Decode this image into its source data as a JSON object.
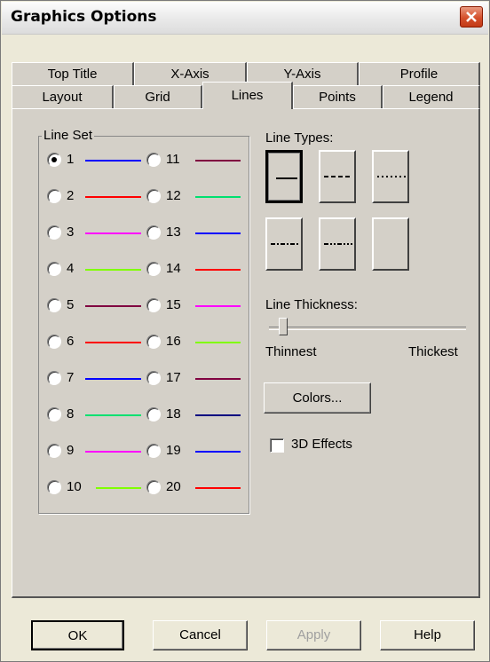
{
  "window": {
    "title": "Graphics Options"
  },
  "tabs": {
    "back_row": [
      "Top Title",
      "X-Axis",
      "Y-Axis",
      "Profile"
    ],
    "front_row": [
      "Layout",
      "Grid",
      "Lines",
      "Points",
      "Legend"
    ],
    "active": "Lines"
  },
  "line_set": {
    "label": "Line Set",
    "selected": "1",
    "items": [
      {
        "label": "1",
        "color": "#0000ff"
      },
      {
        "label": "2",
        "color": "#ff0000"
      },
      {
        "label": "3",
        "color": "#ff00ff"
      },
      {
        "label": "4",
        "color": "#80ff00"
      },
      {
        "label": "5",
        "color": "#800040"
      },
      {
        "label": "6",
        "color": "#ff0000"
      },
      {
        "label": "7",
        "color": "#0000ff"
      },
      {
        "label": "8",
        "color": "#00e070"
      },
      {
        "label": "9",
        "color": "#ff00ff"
      },
      {
        "label": "10",
        "color": "#80ff00"
      },
      {
        "label": "11",
        "color": "#800040"
      },
      {
        "label": "12",
        "color": "#00e070"
      },
      {
        "label": "13",
        "color": "#0000ff"
      },
      {
        "label": "14",
        "color": "#ff0000"
      },
      {
        "label": "15",
        "color": "#ff00ff"
      },
      {
        "label": "16",
        "color": "#80ff00"
      },
      {
        "label": "17",
        "color": "#800040"
      },
      {
        "label": "18",
        "color": "#000080"
      },
      {
        "label": "19",
        "color": "#0000ff"
      },
      {
        "label": "20",
        "color": "#ff0000"
      }
    ]
  },
  "line_types": {
    "label": "Line Types:",
    "selected": "solid",
    "items": [
      "solid",
      "dashed",
      "dotted",
      "dash-dot",
      "dash-dot-dot",
      "none"
    ]
  },
  "line_thickness": {
    "label": "Line Thickness:",
    "min_label": "Thinnest",
    "max_label": "Thickest",
    "value_fraction": 0.0
  },
  "colors_button": "Colors...",
  "effects_3d": {
    "label": "3D Effects",
    "checked": false
  },
  "buttons": {
    "ok": "OK",
    "cancel": "Cancel",
    "apply": "Apply",
    "help": "Help"
  }
}
